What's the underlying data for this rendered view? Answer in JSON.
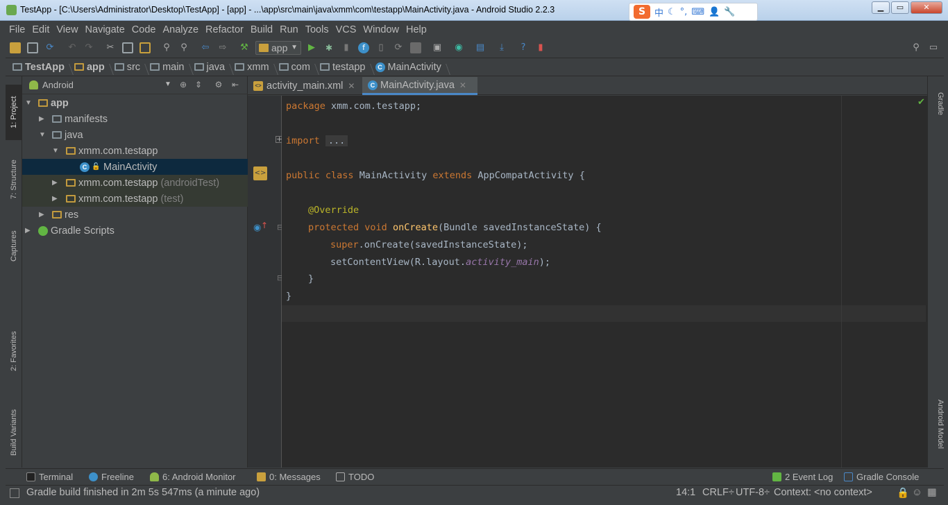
{
  "window": {
    "title": "TestApp - [C:\\Users\\Administrator\\Desktop\\TestApp] - [app] - ...\\app\\src\\main\\java\\xmm\\com\\testapp\\MainActivity.java - Android Studio 2.2.3",
    "ime": {
      "lang": "中",
      "items": [
        "中",
        "☾",
        "°,",
        "⌨",
        "👤",
        "🔧"
      ]
    }
  },
  "menu": [
    "File",
    "Edit",
    "View",
    "Navigate",
    "Code",
    "Analyze",
    "Refactor",
    "Build",
    "Run",
    "Tools",
    "VCS",
    "Window",
    "Help"
  ],
  "toolbar": {
    "run_config": "app"
  },
  "breadcrumb": [
    "TestApp",
    "app",
    "src",
    "main",
    "java",
    "xmm",
    "com",
    "testapp",
    "MainActivity"
  ],
  "left_tabs": [
    "1: Project",
    "7: Structure",
    "Captures",
    "2: Favorites",
    "Build Variants"
  ],
  "right_tabs": [
    "Gradle",
    "Android Model"
  ],
  "project": {
    "view": "Android",
    "tree": [
      {
        "label": "app",
        "dim": ""
      },
      {
        "label": "manifests",
        "dim": ""
      },
      {
        "label": "java",
        "dim": ""
      },
      {
        "label": "xmm.com.testapp",
        "dim": ""
      },
      {
        "label": "MainActivity",
        "dim": ""
      },
      {
        "label": "xmm.com.testapp",
        "dim": "(androidTest)"
      },
      {
        "label": "xmm.com.testapp",
        "dim": "(test)"
      },
      {
        "label": "res",
        "dim": ""
      },
      {
        "label": "Gradle Scripts",
        "dim": ""
      }
    ]
  },
  "editor": {
    "tabs": [
      "activity_main.xml",
      "MainActivity.java"
    ],
    "active_tab": "MainActivity.java",
    "code": {
      "l1_kw": "package",
      "l1_rest": " xmm.com.testapp;",
      "l2_kw": "import",
      "l2_fold": "...",
      "l3_kw1": "public",
      "l3_kw2": "class",
      "l3_name": " MainActivity ",
      "l3_kw3": "extends",
      "l3_rest": " AppCompatActivity {",
      "l4_ann": "@Override",
      "l5_kw1": "protected",
      "l5_kw2": "void",
      "l5_fn": "onCreate",
      "l5_rest": "(Bundle savedInstanceState) {",
      "l6_kw": "super",
      "l6_rest": ".onCreate(savedInstanceState);",
      "l7_pre": "setContentView(R.layout.",
      "l7_it": "activity_main",
      "l7_post": ");",
      "l8": "}",
      "l9": "}"
    }
  },
  "bottom_tools": [
    "Terminal",
    "Freeline",
    "6: Android Monitor",
    "0: Messages",
    "TODO",
    "2 Event Log",
    "Gradle Console"
  ],
  "status": {
    "message": "Gradle build finished in 2m 5s 547ms (a minute ago)",
    "position": "14:1",
    "line_sep": "CRLF÷",
    "encoding": "UTF-8÷",
    "context": "Context: <no context>"
  },
  "colors": {
    "keyword": "#cc7832",
    "annotation": "#bbb529",
    "function": "#ffc66d",
    "field": "#9876aa",
    "background": "#2b2b2b"
  }
}
